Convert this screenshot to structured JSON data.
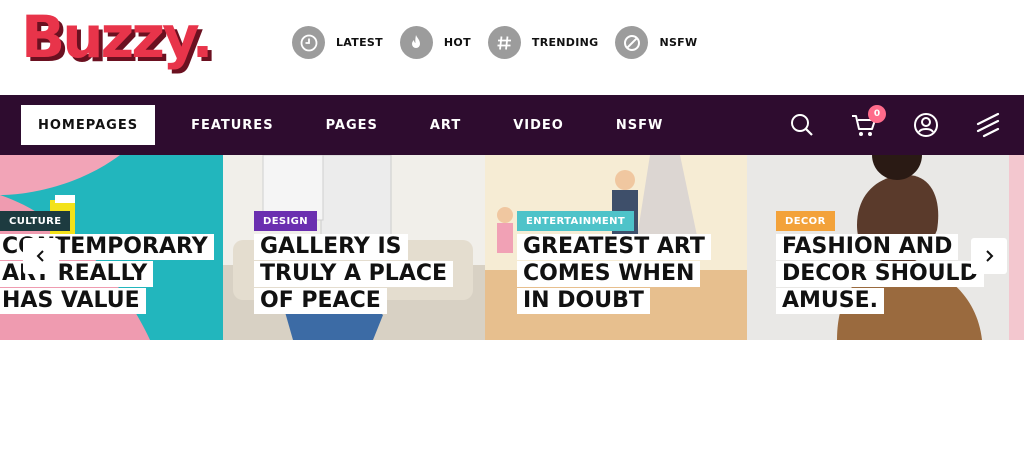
{
  "logo": {
    "text": "Buzzy."
  },
  "quick_links": [
    {
      "label": "LATEST",
      "icon": "clock-icon"
    },
    {
      "label": "HOT",
      "icon": "flame-icon"
    },
    {
      "label": "TRENDING",
      "icon": "hash-icon"
    },
    {
      "label": "NSFW",
      "icon": "ban-icon"
    }
  ],
  "nav": {
    "items": [
      "HOMEPAGES",
      "FEATURES",
      "PAGES",
      "ART",
      "VIDEO",
      "NSFW"
    ],
    "active": "HOMEPAGES",
    "actions": [
      "search-icon",
      "cart-icon",
      "user-icon",
      "menu-icon"
    ],
    "cart_count": "0"
  },
  "slides": [
    {
      "category": "CULTURE",
      "category_color": "#1d3b40",
      "title": "CONTEMPORARY ART REALLY HAS VALUE"
    },
    {
      "category": "DESIGN",
      "category_color": "#6b2fb0",
      "title": "GALLERY IS TRULY A PLACE OF PEACE"
    },
    {
      "category": "ENTERTAINMENT",
      "category_color": "#4ec3c9",
      "title": "GREATEST ART COMES WHEN IN DOUBT"
    },
    {
      "category": "DECOR",
      "category_color": "#f3a23a",
      "title": "FASHION AND DECOR SHOULD AMUSE."
    }
  ],
  "colors": {
    "brand": "#e8344a",
    "nav_bg": "#2e0c2f"
  }
}
